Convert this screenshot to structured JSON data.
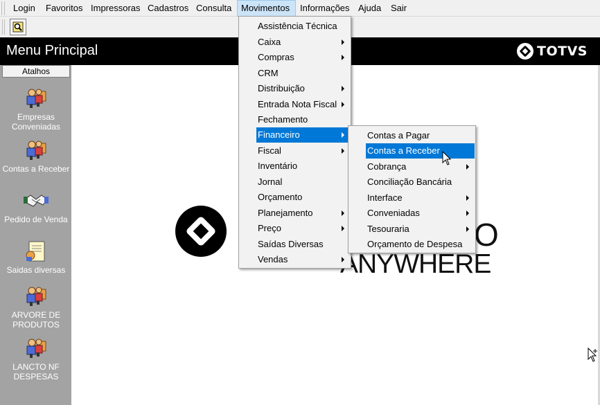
{
  "menubar": {
    "items": [
      {
        "label": "Login"
      },
      {
        "label": "Favoritos"
      },
      {
        "label": "Impressoras"
      },
      {
        "label": "Cadastros"
      },
      {
        "label": "Consulta"
      },
      {
        "label": "Movimentos"
      },
      {
        "label": "Informações"
      },
      {
        "label": "Ajuda"
      },
      {
        "label": "Sair"
      }
    ],
    "open_item": "Movimentos"
  },
  "header": {
    "title": "Menu Principal",
    "brand": "TOTVS"
  },
  "shortcuts": {
    "title": "Atalhos",
    "items": [
      {
        "label": "Empresas Conveniadas",
        "icon": "people-icon"
      },
      {
        "label": "Contas a Receber",
        "icon": "people-icon"
      },
      {
        "label": "Pedido de Venda",
        "icon": "handshake-icon"
      },
      {
        "label": "Saidas diversas",
        "icon": "document-icon"
      },
      {
        "label": "ARVORE DE PRODUTOS",
        "icon": "people-icon"
      },
      {
        "label": "LANCTO NF DESPESAS",
        "icon": "people-icon"
      }
    ]
  },
  "background": {
    "text_o": "O",
    "text_anywhere": "ANYWHERE"
  },
  "movimentos_menu": {
    "items": [
      {
        "label": "Assistência Técnica",
        "submenu": false
      },
      {
        "label": "Caixa",
        "submenu": true
      },
      {
        "label": "Compras",
        "submenu": true
      },
      {
        "label": "CRM",
        "submenu": false
      },
      {
        "label": "Distribuição",
        "submenu": true
      },
      {
        "label": "Entrada Nota Fiscal",
        "submenu": true
      },
      {
        "label": "Fechamento",
        "submenu": false
      },
      {
        "label": "Financeiro",
        "submenu": true
      },
      {
        "label": "Fiscal",
        "submenu": true
      },
      {
        "label": "Inventário",
        "submenu": false
      },
      {
        "label": "Jornal",
        "submenu": false
      },
      {
        "label": "Orçamento",
        "submenu": false
      },
      {
        "label": "Planejamento",
        "submenu": true
      },
      {
        "label": "Preço",
        "submenu": true
      },
      {
        "label": "Saídas Diversas",
        "submenu": false
      },
      {
        "label": "Vendas",
        "submenu": true
      }
    ],
    "highlighted": "Financeiro"
  },
  "financeiro_menu": {
    "items": [
      {
        "label": "Contas a Pagar",
        "submenu": false
      },
      {
        "label": "Contas a Receber",
        "submenu": false
      },
      {
        "label": "Cobrança",
        "submenu": true
      },
      {
        "label": "Conciliação Bancária",
        "submenu": false
      },
      {
        "label": "Interface",
        "submenu": true
      },
      {
        "label": "Conveniadas",
        "submenu": true
      },
      {
        "label": "Tesouraria",
        "submenu": true
      },
      {
        "label": "Orçamento de Despesa",
        "submenu": false
      }
    ],
    "highlighted": "Contas a Receber"
  },
  "colors": {
    "highlight": "#0078d7",
    "header_bg": "#000000",
    "panel_bg": "#a3a3a3"
  }
}
